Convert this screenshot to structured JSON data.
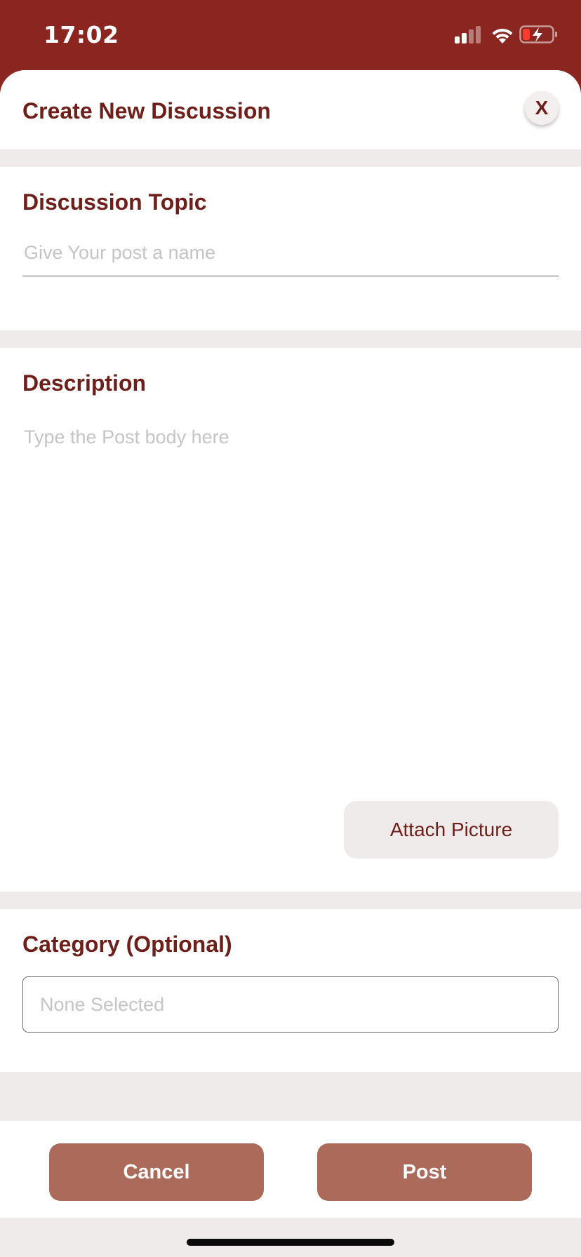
{
  "status_bar": {
    "time": "17:02",
    "signal_icon": "cellular-signal-icon",
    "wifi_icon": "wifi-icon",
    "battery_icon": "battery-charging-low-icon"
  },
  "header": {
    "title": "Create New Discussion",
    "close_label": "X"
  },
  "topic": {
    "label": "Discussion Topic",
    "value": "",
    "placeholder": "Give Your post a name"
  },
  "description": {
    "label": "Description",
    "value": "",
    "placeholder": "Type the Post body here",
    "attach_label": "Attach Picture"
  },
  "category": {
    "label": "Category (Optional)",
    "selected": "None Selected"
  },
  "actions": {
    "cancel_label": "Cancel",
    "post_label": "Post"
  },
  "colors": {
    "brand": "#8b2520",
    "heading": "#6e1f1a",
    "button": "#ab6a5a",
    "background": "#efebea"
  }
}
